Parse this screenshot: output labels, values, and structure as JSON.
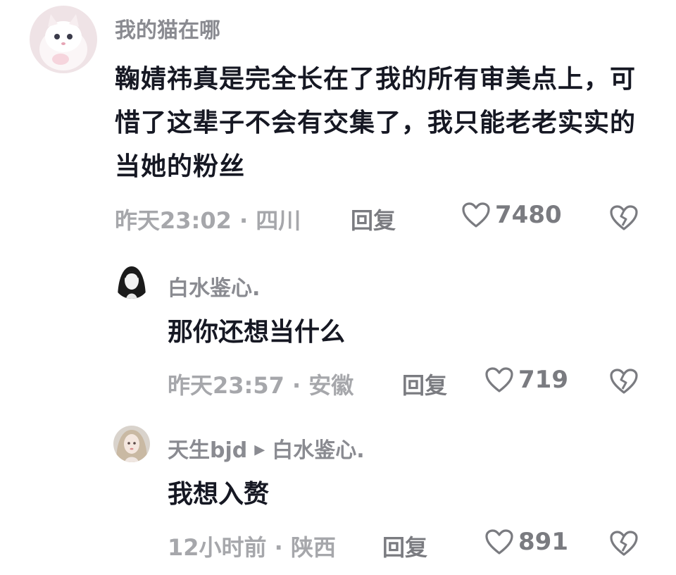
{
  "comments": [
    {
      "username": "我的猫在哪",
      "content": "鞠婧祎真是完全长在了我的所有审美点上，可惜了这辈子不会有交集了，我只能老老实实的当她的粉丝",
      "time_location": "昨天23:02 · 四川",
      "reply_label": "回复",
      "likes": "7480",
      "avatar_icon": "white-kitten-avatar"
    },
    {
      "username": "白水鉴心.",
      "content": "那你还想当什么",
      "time_location": "昨天23:57 · 安徽",
      "reply_label": "回复",
      "likes": "719",
      "avatar_icon": "sketch-girl-avatar"
    },
    {
      "username": "天生bjd",
      "reply_to": "白水鉴心.",
      "content": "我想入赘",
      "time_location": "12小时前 · 陕西",
      "reply_label": "回复",
      "likes": "891",
      "avatar_icon": "doll-avatar"
    }
  ],
  "icons": {
    "like": "heart-outline-icon",
    "dislike": "broken-heart-icon",
    "reply_arrow": "triangle-right-icon"
  },
  "colors": {
    "username": "#8a8b91",
    "content": "#161823",
    "meta": "#a6a7ab",
    "action": "#7a7b80"
  }
}
